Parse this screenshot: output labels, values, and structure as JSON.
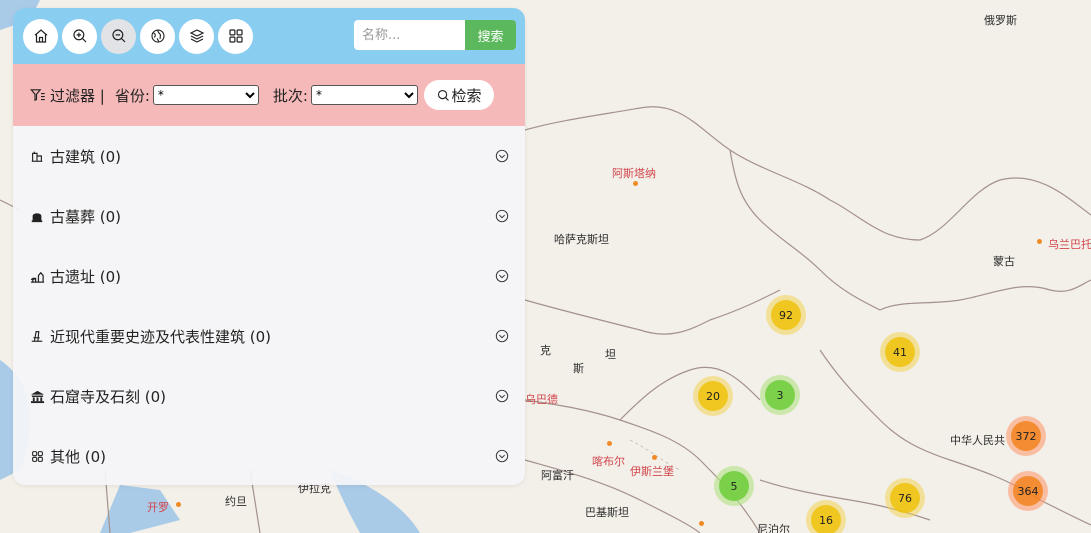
{
  "toolbar": {
    "buttons": [
      "home",
      "zoom-in",
      "zoom-out",
      "globe",
      "layers",
      "grid"
    ],
    "search_placeholder": "名称...",
    "search_label": "搜索"
  },
  "filter": {
    "title": "过滤器 |",
    "province_label": "省份:",
    "province_value": "*",
    "batch_label": "批次:",
    "batch_value": "*",
    "check_label": "检索"
  },
  "categories": [
    {
      "label": "古建筑 (0)",
      "icon": "building-icon"
    },
    {
      "label": "古墓葬 (0)",
      "icon": "tomb-icon"
    },
    {
      "label": "古遗址 (0)",
      "icon": "ruins-icon"
    },
    {
      "label": "近现代重要史迹及代表性建筑 (0)",
      "icon": "monument-icon"
    },
    {
      "label": "石窟寺及石刻 (0)",
      "icon": "temple-icon"
    },
    {
      "label": "其他 (0)",
      "icon": "other-icon"
    }
  ],
  "map": {
    "labels": [
      "俄罗斯",
      "哈萨克斯坦",
      "蒙古",
      "中华人民共",
      "阿富汗",
      "巴基斯坦",
      "尼泊尔",
      "克",
      "斯",
      "坦",
      "约旦",
      "伊拉克"
    ],
    "cities": [
      "阿斯塔纳",
      "乌兰巴托",
      "喀布尔",
      "伊斯兰堡",
      "开罗",
      "乌巴德"
    ],
    "clusters": [
      {
        "count": "92",
        "color": "yellow"
      },
      {
        "count": "41",
        "color": "yellow"
      },
      {
        "count": "20",
        "color": "yellow"
      },
      {
        "count": "3",
        "color": "green"
      },
      {
        "count": "372",
        "color": "orange"
      },
      {
        "count": "5",
        "color": "green"
      },
      {
        "count": "76",
        "color": "yellow"
      },
      {
        "count": "364",
        "color": "orange"
      },
      {
        "count": "16",
        "color": "yellow"
      }
    ]
  },
  "colors": {
    "toolbar_bg": "#89cdf1",
    "filter_bg": "#f6b9b9",
    "search_button": "#5cb85c",
    "map_land": "#f3efe9",
    "water": "#a9cbe8"
  }
}
